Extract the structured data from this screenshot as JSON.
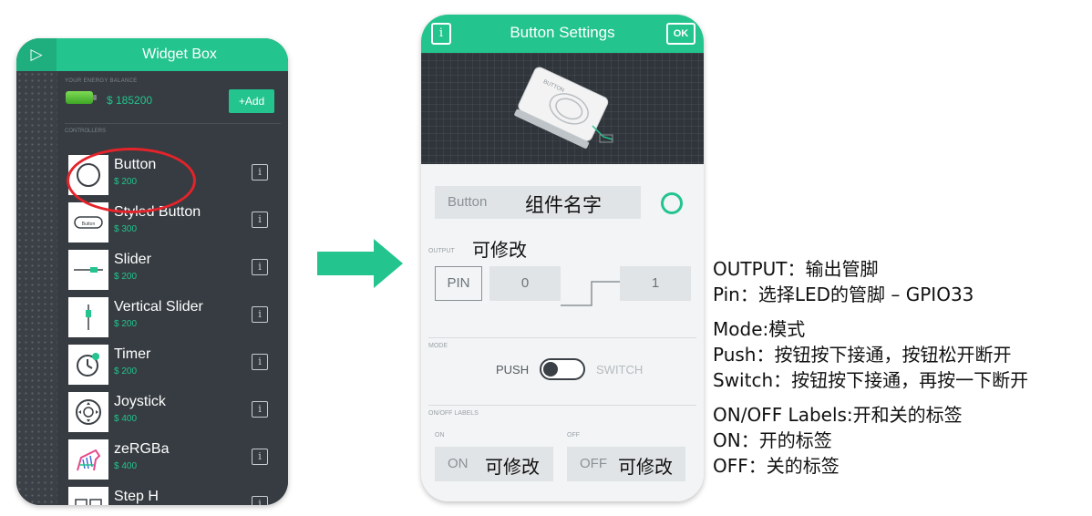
{
  "widget_box": {
    "title": "Widget Box",
    "energy_label": "YOUR ENERGY BALANCE",
    "balance": "$ 185200",
    "add_label": "+Add",
    "controllers_label": "CONTROLLERS",
    "items": [
      {
        "name": "Button",
        "price": "$ 200",
        "icon": "button-circle-icon"
      },
      {
        "name": "Styled Button",
        "price": "$ 300",
        "icon": "styled-button-icon"
      },
      {
        "name": "Slider",
        "price": "$ 200",
        "icon": "slider-icon"
      },
      {
        "name": "Vertical Slider",
        "price": "$ 200",
        "icon": "vertical-slider-icon"
      },
      {
        "name": "Timer",
        "price": "$ 200",
        "icon": "timer-icon"
      },
      {
        "name": "Joystick",
        "price": "$ 400",
        "icon": "joystick-icon"
      },
      {
        "name": "zeRGBa",
        "price": "$ 400",
        "icon": "zebra-icon"
      },
      {
        "name": "Step H",
        "price": "",
        "icon": "step-h-icon"
      }
    ],
    "info_glyph": "i",
    "highlight_color": "#e5232b",
    "accent_color": "#23c48e"
  },
  "button_settings": {
    "title": "Button Settings",
    "ok_label": "OK",
    "info_glyph": "i",
    "device_label": "BUTTON",
    "name_value": "Button",
    "name_note": "组件名字",
    "output_label": "OUTPUT",
    "output_note": "可修改",
    "pin_label": "PIN",
    "pin_low": "0",
    "pin_high": "1",
    "mode_label": "MODE",
    "push_label": "PUSH",
    "switch_label": "SWITCH",
    "onoff_label": "ON/OFF LABELS",
    "on_label": "ON",
    "off_label": "OFF",
    "on_value": "ON",
    "off_value": "OFF",
    "on_note": "可修改",
    "off_note": "可修改"
  },
  "notes": {
    "output": "OUTPUT：输出管脚",
    "pin": "Pin：选择LED的管脚 – GPIO33",
    "mode": "Mode:模式",
    "push": "Push：按钮按下接通，按钮松开断开",
    "switch": "Switch：按钮按下接通，再按一下断开",
    "labels": "ON/OFF Labels:开和关的标签",
    "on": "ON：开的标签",
    "off": "OFF：关的标签"
  }
}
